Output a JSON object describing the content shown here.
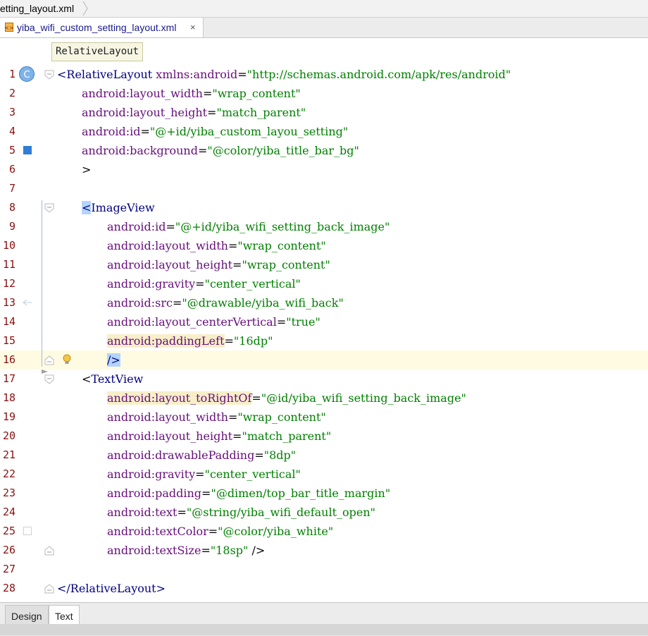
{
  "breadcrumb": {
    "file": "etting_layout.xml"
  },
  "editor_tab": {
    "label": "yiba_wifi_custom_setting_layout.xml",
    "close": "×"
  },
  "tooltip": {
    "text": "RelativeLayout"
  },
  "gutter_icons": {
    "class_marker": "C",
    "class_icon": "class-c-icon",
    "color_swatch_5": "#2f7dd6",
    "color_swatch_25": "#ffffff"
  },
  "lines": [
    {
      "n": "1",
      "parts": [
        [
          "tag",
          "<RelativeLayout "
        ],
        [
          "attr",
          "xmlns:android"
        ],
        [
          "p",
          "="
        ],
        [
          "val",
          "\"http://schemas.android.com/apk/res/android\""
        ]
      ]
    },
    {
      "n": "2",
      "parts": [
        [
          "attr",
          "android:layout_width"
        ],
        [
          "p",
          "="
        ],
        [
          "val",
          "\"wrap_content\""
        ]
      ]
    },
    {
      "n": "3",
      "parts": [
        [
          "attr",
          "android:layout_height"
        ],
        [
          "p",
          "="
        ],
        [
          "val",
          "\"match_parent\""
        ]
      ]
    },
    {
      "n": "4",
      "parts": [
        [
          "attr",
          "android:id"
        ],
        [
          "p",
          "="
        ],
        [
          "val",
          "\"@+id/yiba_custom_layou_setting\""
        ]
      ]
    },
    {
      "n": "5",
      "parts": [
        [
          "attr",
          "android:background"
        ],
        [
          "p",
          "="
        ],
        [
          "val",
          "\"@color/yiba_title_bar_bg\""
        ]
      ]
    },
    {
      "n": "6",
      "parts": [
        [
          "p",
          ">"
        ]
      ]
    },
    {
      "n": "7",
      "parts": []
    },
    {
      "n": "8",
      "parts": [
        [
          "bracket",
          "<"
        ],
        [
          "tagb",
          "ImageView"
        ]
      ]
    },
    {
      "n": "9",
      "parts": [
        [
          "attr",
          "android:id"
        ],
        [
          "p",
          "="
        ],
        [
          "val",
          "\"@+id/yiba_wifi_setting_back_image\""
        ]
      ]
    },
    {
      "n": "10",
      "parts": [
        [
          "attr",
          "android:layout_width"
        ],
        [
          "p",
          "="
        ],
        [
          "val",
          "\"wrap_content\""
        ]
      ]
    },
    {
      "n": "11",
      "parts": [
        [
          "attr",
          "android:layout_height"
        ],
        [
          "p",
          "="
        ],
        [
          "val",
          "\"wrap_content\""
        ]
      ]
    },
    {
      "n": "12",
      "parts": [
        [
          "attr",
          "android:gravity"
        ],
        [
          "p",
          "="
        ],
        [
          "val",
          "\"center_vertical\""
        ]
      ]
    },
    {
      "n": "13",
      "parts": [
        [
          "attr",
          "android:src"
        ],
        [
          "p",
          "="
        ],
        [
          "val",
          "\"@drawable/yiba_wifi_back\""
        ]
      ]
    },
    {
      "n": "14",
      "parts": [
        [
          "attr",
          "android:layout_centerVertical"
        ],
        [
          "p",
          "="
        ],
        [
          "val",
          "\"true\""
        ]
      ]
    },
    {
      "n": "15",
      "parts": [
        [
          "attrhl",
          "android:paddingLeft"
        ],
        [
          "p",
          "="
        ],
        [
          "val",
          "\"16dp\""
        ]
      ]
    },
    {
      "n": "16",
      "parts": [
        [
          "bracket",
          "/>"
        ]
      ]
    },
    {
      "n": "17",
      "parts": [
        [
          "p",
          "<"
        ],
        [
          "tagb",
          "TextView"
        ]
      ]
    },
    {
      "n": "18",
      "parts": [
        [
          "attrhl",
          "android:layout_toRightOf"
        ],
        [
          "p",
          "="
        ],
        [
          "val",
          "\"@id/yiba_wifi_setting_back_image\""
        ]
      ]
    },
    {
      "n": "19",
      "parts": [
        [
          "attr",
          "android:layout_width"
        ],
        [
          "p",
          "="
        ],
        [
          "val",
          "\"wrap_content\""
        ]
      ]
    },
    {
      "n": "20",
      "parts": [
        [
          "attr",
          "android:layout_height"
        ],
        [
          "p",
          "="
        ],
        [
          "val",
          "\"match_parent\""
        ]
      ]
    },
    {
      "n": "21",
      "parts": [
        [
          "attr",
          "android:drawablePadding"
        ],
        [
          "p",
          "="
        ],
        [
          "val",
          "\"8dp\""
        ]
      ]
    },
    {
      "n": "22",
      "parts": [
        [
          "attr",
          "android:gravity"
        ],
        [
          "p",
          "="
        ],
        [
          "val",
          "\"center_vertical\""
        ]
      ]
    },
    {
      "n": "23",
      "parts": [
        [
          "attr",
          "android:padding"
        ],
        [
          "p",
          "="
        ],
        [
          "val",
          "\"@dimen/top_bar_title_margin\""
        ]
      ]
    },
    {
      "n": "24",
      "parts": [
        [
          "attr",
          "android:text"
        ],
        [
          "p",
          "="
        ],
        [
          "val",
          "\"@string/yiba_wifi_default_open\""
        ]
      ]
    },
    {
      "n": "25",
      "parts": [
        [
          "attr",
          "android:textColor"
        ],
        [
          "p",
          "="
        ],
        [
          "val",
          "\"@color/yiba_white\""
        ]
      ]
    },
    {
      "n": "26",
      "parts": [
        [
          "attr",
          "android:textSize"
        ],
        [
          "p",
          "="
        ],
        [
          "val",
          "\"18sp\""
        ],
        [
          "p",
          " />"
        ]
      ]
    },
    {
      "n": "27",
      "parts": []
    },
    {
      "n": "28",
      "parts": [
        [
          "tag",
          "</RelativeLayout>"
        ]
      ]
    }
  ],
  "bottom_tabs": {
    "design": "Design",
    "text": "Text"
  }
}
